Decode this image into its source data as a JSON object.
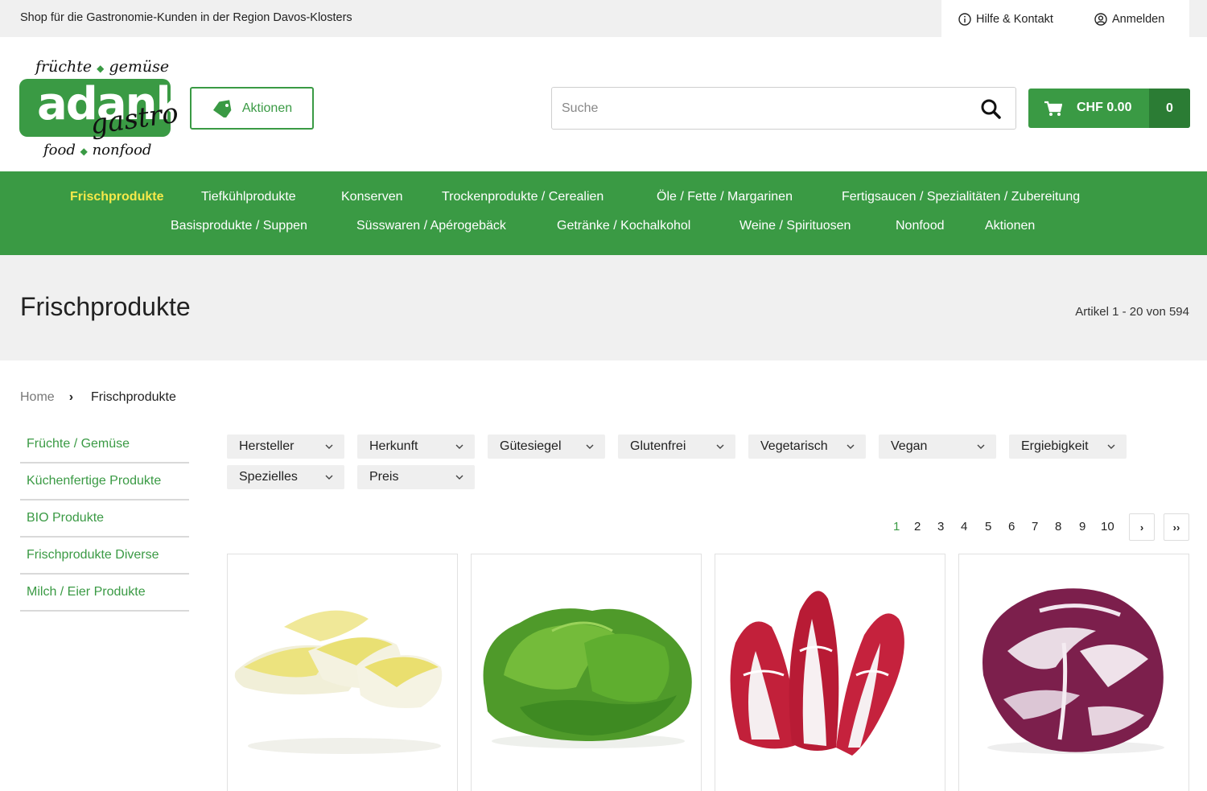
{
  "topbar": {
    "tagline": "Shop für die Gastronomie-Kunden in der Region Davos-Klosters",
    "help": "Hilfe & Kontakt",
    "login": "Anmelden"
  },
  "logo": {
    "top": "früchte",
    "top2": "gemüse",
    "main": "adank",
    "script": "gastro",
    "bottom": "food",
    "bottom2": "nonfood"
  },
  "header": {
    "aktionen": "Aktionen",
    "search_placeholder": "Suche",
    "cart_amount": "CHF 0.00",
    "cart_count": "0"
  },
  "nav": {
    "row1": [
      "Frischprodukte",
      "Tiefkühlprodukte",
      "Konserven",
      "Trockenprodukte / Cerealien",
      "Öle / Fette / Margarinen",
      "Fertigsaucen / Spezialitäten / Zubereitung"
    ],
    "row2": [
      "Basisprodukte / Suppen",
      "Süsswaren / Apérogebäck",
      "Getränke / Kochalkohol",
      "Weine / Spirituosen",
      "Nonfood",
      "Aktionen"
    ]
  },
  "page": {
    "title": "Frischprodukte",
    "count": "Artikel 1 - 20 von 594"
  },
  "breadcrumb": {
    "home": "Home",
    "sep": "›",
    "current": "Frischprodukte"
  },
  "sidebar": {
    "items": [
      "Früchte / Gemüse",
      "Küchenfertige Produkte",
      "BIO Produkte",
      "Frischprodukte Diverse",
      "Milch / Eier Produkte"
    ]
  },
  "filters": [
    "Hersteller",
    "Herkunft",
    "Gütesiegel",
    "Glutenfrei",
    "Vegetarisch",
    "Vegan",
    "Ergiebigkeit",
    "Spezielles",
    "Preis"
  ],
  "pagination": {
    "pages": [
      "1",
      "2",
      "3",
      "4",
      "5",
      "6",
      "7",
      "8",
      "9",
      "10"
    ],
    "current": "1",
    "next": "›",
    "last": "››"
  },
  "products": [
    {
      "image": "chicoree-image"
    },
    {
      "image": "lettuce-image"
    },
    {
      "image": "red-chicory-image"
    },
    {
      "image": "radicchio-image"
    }
  ],
  "colors": {
    "brand_green": "#3a9a44",
    "dark_green": "#2b7c34",
    "nav_active": "#f5e94a",
    "band_gray": "#f0f0f0"
  }
}
